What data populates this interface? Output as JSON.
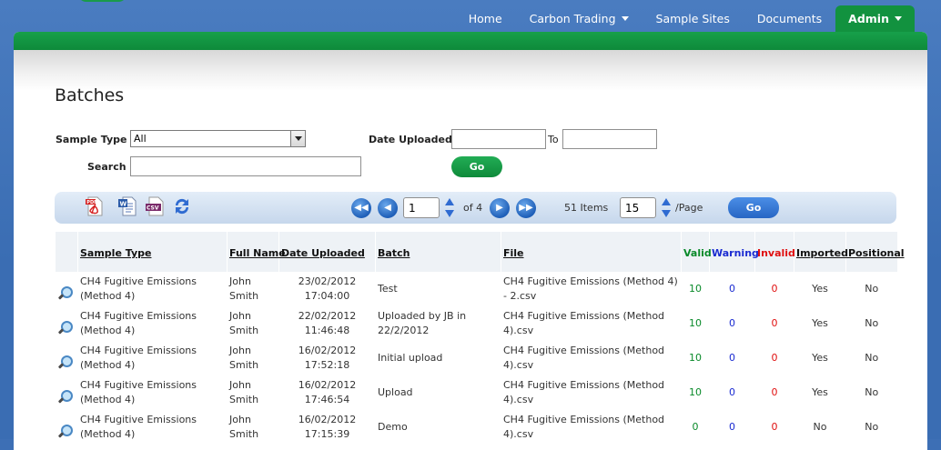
{
  "nav": {
    "items": [
      {
        "label": "Home",
        "dropdown": false
      },
      {
        "label": "Carbon Trading",
        "dropdown": true
      },
      {
        "label": "Sample Sites",
        "dropdown": false
      },
      {
        "label": "Documents",
        "dropdown": false
      }
    ],
    "active": {
      "label": "Admin",
      "dropdown": true
    }
  },
  "page": {
    "title": "Batches"
  },
  "filters": {
    "sample_type_label": "Sample Type",
    "sample_type_value": "All",
    "date_uploaded_label": "Date Uploaded",
    "date_from": "",
    "to_label": "To",
    "date_to": "",
    "search_label": "Search",
    "search_value": "",
    "go_label": "Go"
  },
  "toolbar": {
    "icons": [
      "pdf-export-icon",
      "word-export-icon",
      "csv-export-icon",
      "refresh-icon"
    ],
    "page_value": "1",
    "of_pages": "of 4",
    "items_count": "51 Items",
    "page_size": "15",
    "per_page": "/Page",
    "go_label": "Go"
  },
  "table": {
    "headers": {
      "sample_type": "Sample Type",
      "full_name": "Full Name",
      "date_uploaded": "Date Uploaded",
      "batch": "Batch",
      "file": "File",
      "valid": "Valid",
      "warning": "Warning",
      "invalid": "Invalid",
      "imported": "Imported",
      "positional": "Positional"
    },
    "rows": [
      {
        "sample_type": "CH4 Fugitive Emissions (Method 4)",
        "full_name": "John Smith",
        "date": "23/02/2012",
        "time": "17:04:00",
        "batch": "Test",
        "file": "CH4 Fugitive Emissions (Method 4) - 2.csv",
        "valid": "10",
        "warning": "0",
        "invalid": "0",
        "imported": "Yes",
        "positional": "No"
      },
      {
        "sample_type": "CH4 Fugitive Emissions (Method 4)",
        "full_name": "John Smith",
        "date": "22/02/2012",
        "time": "11:46:48",
        "batch": "Uploaded by JB in 22/2/2012",
        "file": "CH4 Fugitive Emissions (Method 4).csv",
        "valid": "10",
        "warning": "0",
        "invalid": "0",
        "imported": "Yes",
        "positional": "No"
      },
      {
        "sample_type": "CH4 Fugitive Emissions (Method 4)",
        "full_name": "John Smith",
        "date": "16/02/2012",
        "time": "17:52:18",
        "batch": "Initial upload",
        "file": "CH4 Fugitive Emissions (Method 4).csv",
        "valid": "10",
        "warning": "0",
        "invalid": "0",
        "imported": "Yes",
        "positional": "No"
      },
      {
        "sample_type": "CH4 Fugitive Emissions (Method 4)",
        "full_name": "John Smith",
        "date": "16/02/2012",
        "time": "17:46:54",
        "batch": "Upload",
        "file": "CH4 Fugitive Emissions (Method 4).csv",
        "valid": "10",
        "warning": "0",
        "invalid": "0",
        "imported": "Yes",
        "positional": "No"
      },
      {
        "sample_type": "CH4 Fugitive Emissions (Method 4)",
        "full_name": "John Smith",
        "date": "16/02/2012",
        "time": "17:15:39",
        "batch": "Demo",
        "file": "CH4 Fugitive Emissions (Method 4).csv",
        "valid": "0",
        "warning": "0",
        "invalid": "0",
        "imported": "No",
        "positional": "No"
      }
    ]
  }
}
